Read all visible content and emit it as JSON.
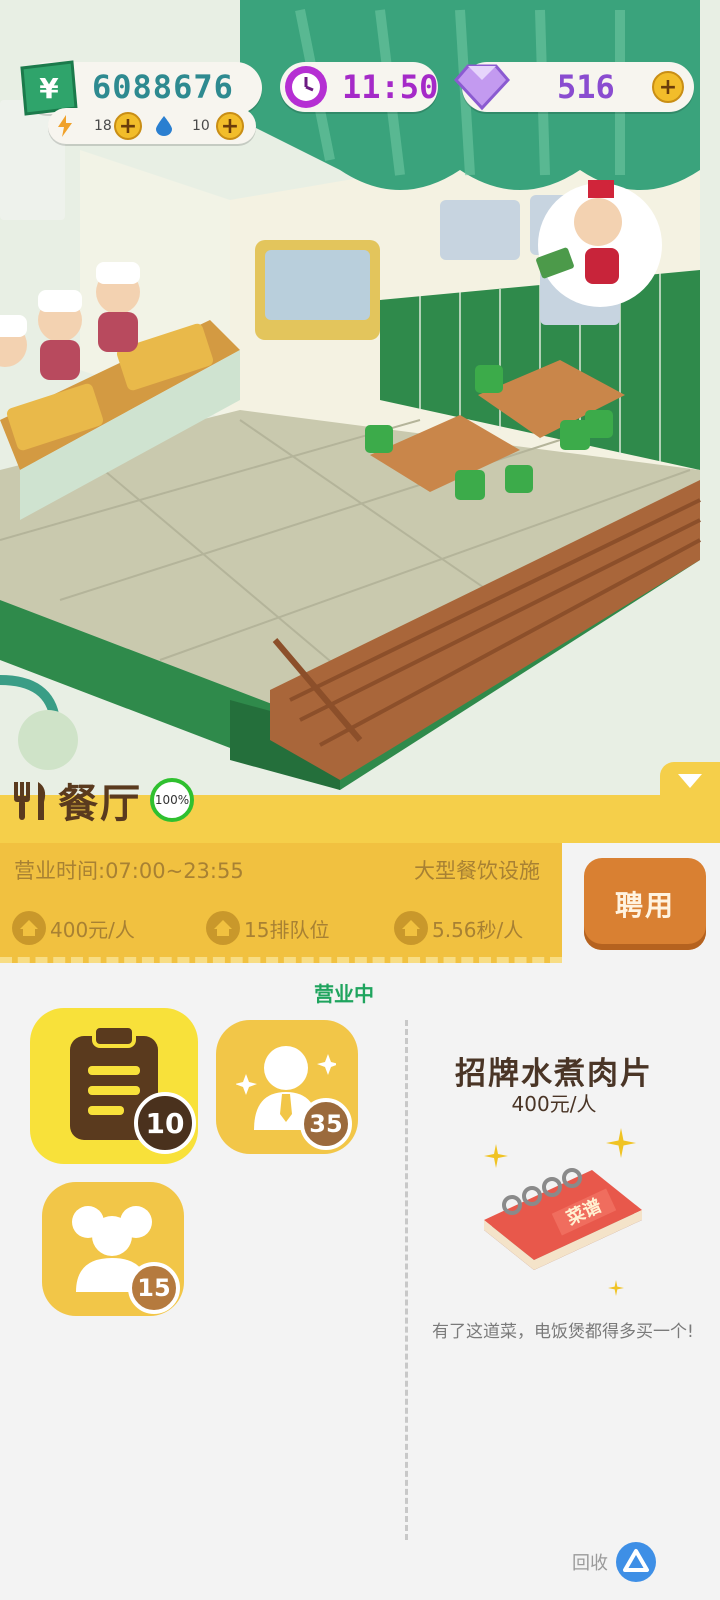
{
  "hud": {
    "money": "6088676",
    "energy": "18",
    "water": "10",
    "time": "11:50",
    "gems": "516",
    "money_symbol": "¥"
  },
  "panel": {
    "title": "餐厅",
    "progress": "100%",
    "progress_value": 1.0,
    "hours": "营业时间:07:00~23:55",
    "facility": "大型餐饮设施",
    "stats": {
      "price": "400元/人",
      "queue": "15排队位",
      "speed": "5.56秒/人"
    },
    "hire_label": "聘用",
    "status": "营业中"
  },
  "tiles": {
    "menu_count": "10",
    "staff_count": "35",
    "guests_count": "15"
  },
  "dish": {
    "name": "招牌水煮肉片",
    "price": "400元/人",
    "book_label": "菜谱",
    "description": "有了这道菜，电饭煲都得多买一个!"
  },
  "recycle_label": "回收",
  "colors": {
    "panel_yellow": "#f5cf4a",
    "ticket_yellow": "#f1c140",
    "hire_orange": "#d98032",
    "status_green": "#1fa45e",
    "wall_green": "#2f8a4b",
    "money_teal": "#2e8a90",
    "time_purple": "#a52ac8",
    "gem_purple": "#8a4cd0"
  },
  "icons": [
    "money-icon",
    "energy-icon",
    "water-icon",
    "clock-icon",
    "gem-icon",
    "plus-icon",
    "fork-knife-icon",
    "home-icon",
    "clipboard-icon",
    "person-icon",
    "group-icon",
    "recipe-book-icon",
    "sparkle-icon",
    "recycle-icon",
    "chevron-down-icon"
  ]
}
